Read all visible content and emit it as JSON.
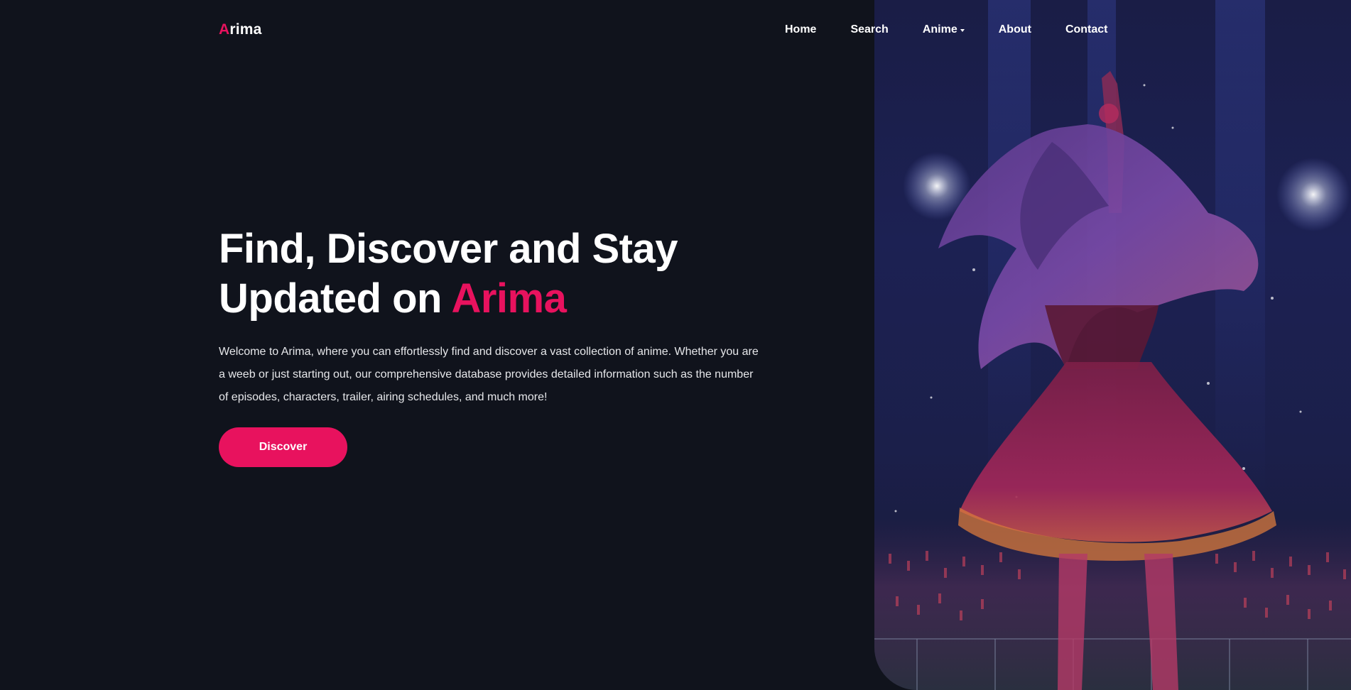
{
  "brand": {
    "accent_letter": "A",
    "rest": "rima"
  },
  "nav": {
    "items": [
      {
        "label": "Home"
      },
      {
        "label": "Search"
      },
      {
        "label": "Anime",
        "has_dropdown": true
      },
      {
        "label": "About"
      },
      {
        "label": "Contact"
      }
    ]
  },
  "hero": {
    "title_line1": "Find, Discover and Stay",
    "title_line2_prefix": "Updated on ",
    "title_line2_accent": "Arima",
    "description": "Welcome to Arima, where you can effortlessly find and discover a vast collection of anime. Whether you are a weeb or just starting out, our comprehensive database provides detailed information such as the number of episodes, characters, trailer, airing schedules, and much more!",
    "cta_label": "Discover"
  },
  "icons": {
    "anime_dropdown": "chevron-down-icon"
  },
  "colors": {
    "background": "#10131c",
    "accent": "#e8125e",
    "text": "#ffffff",
    "muted_text": "#e6e7ea"
  }
}
